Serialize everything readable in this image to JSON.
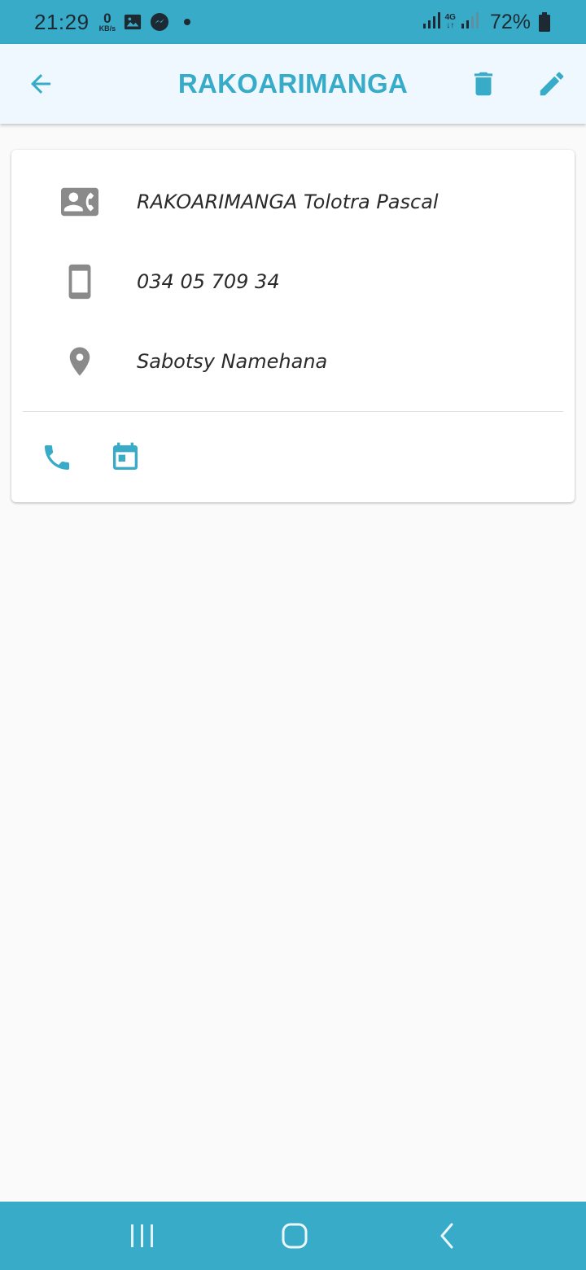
{
  "status_bar": {
    "time": "21:29",
    "net_speed_value": "0",
    "net_speed_unit": "KB/s",
    "network_type": "4G",
    "battery": "72%",
    "icons": [
      "gallery-icon",
      "messenger-icon",
      "notification-dot",
      "signal-icon",
      "signal-icon-2",
      "battery-icon"
    ]
  },
  "app_bar": {
    "title": "RAKOARIMANGA",
    "icons": [
      "back-arrow-icon",
      "delete-icon",
      "edit-icon"
    ]
  },
  "contact": {
    "full_name": "RAKOARIMANGA Tolotra Pascal",
    "phone": "034 05 709 34",
    "address": "Sabotsy Namehana",
    "icons": [
      "contact-card-icon",
      "smartphone-icon",
      "location-pin-icon"
    ]
  },
  "actions": {
    "icons": [
      "phone-icon",
      "calendar-icon"
    ]
  },
  "nav_bar": {
    "icons": [
      "recents-icon",
      "home-icon",
      "back-icon"
    ]
  },
  "colors": {
    "accent": "#37abc8",
    "app_bar_bg": "#eef8fe",
    "page_bg": "#fafafa",
    "icon_gray": "#8a8a8a",
    "text": "#2a2a2a"
  }
}
